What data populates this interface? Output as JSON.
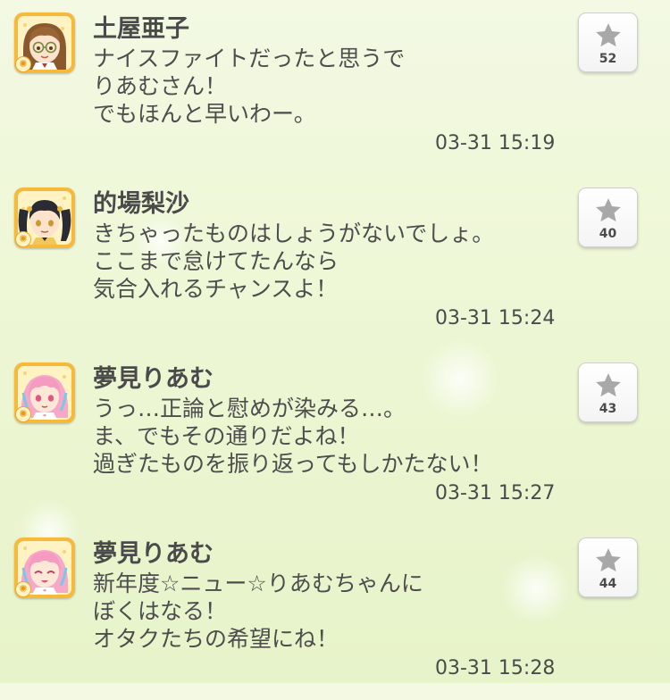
{
  "posts": [
    {
      "avatar_icon": "character-glasses-avatar-icon",
      "name": "土屋亜子",
      "lines": [
        "ナイスファイトだったと思うで",
        "りあむさん！",
        "でもほんと早いわー。"
      ],
      "timestamp": "03-31 15:19",
      "likes": "52"
    },
    {
      "avatar_icon": "character-twintails-avatar-icon",
      "name": "的場梨沙",
      "lines": [
        "きちゃったものはしょうがないでしょ。",
        "ここまで怠けてたんなら",
        "気合入れるチャンスよ！"
      ],
      "timestamp": "03-31 15:24",
      "likes": "40"
    },
    {
      "avatar_icon": "character-pink-hair-avatar-icon",
      "name": "夢見りあむ",
      "lines": [
        "うっ…正論と慰めが染みる…。",
        "ま、でもその通りだよね！",
        "過ぎたものを振り返ってもしかたない！"
      ],
      "timestamp": "03-31 15:27",
      "likes": "43"
    },
    {
      "avatar_icon": "character-pink-hair-smiling-avatar-icon",
      "name": "夢見りあむ",
      "lines": [
        "新年度☆ニュー☆りあむちゃんに",
        "ぼくはなる！",
        "オタクたちの希望にね！"
      ],
      "timestamp": "03-31 15:28",
      "likes": "44"
    }
  ],
  "colors": {
    "avatar_frame": "#f6b93a",
    "star": "#a8a8a8",
    "text": "#4a4a4a",
    "background": "#eef7d6"
  }
}
